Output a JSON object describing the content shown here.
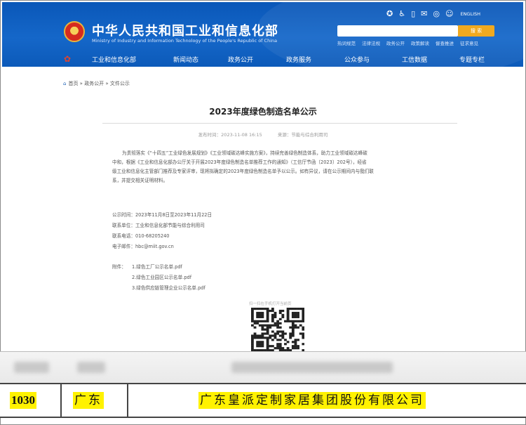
{
  "header": {
    "site_title": "中华人民共和国工业和信息化部",
    "site_subtitle": "Ministry of Industry and Information Technology of the People's Republic of China",
    "lang_link": "ENGLISH",
    "search_button": "搜 索",
    "hot_words": [
      "热词规范",
      "法律法规",
      "政务公开",
      "政策解读",
      "督查推进",
      "征求意见"
    ],
    "nav": [
      "工业和信息化部",
      "新闻动态",
      "政务公开",
      "政务服务",
      "公众参与",
      "工信数据",
      "专题专栏"
    ],
    "top_icons": [
      "weibo-icon",
      "accessibility-icon",
      "bookmark-icon",
      "mail-icon",
      "weibo-icon",
      "wechat-icon"
    ]
  },
  "breadcrumb": [
    "首页",
    "政务公开",
    "文件公示"
  ],
  "article": {
    "title": "2023年度绿色制造名单公示",
    "date": "发布时间：2023-11-08 16:15",
    "source": "来源：节能与综合利用司",
    "para1_lines": [
      "为贯彻落实《“十四五”工业绿色发展规划》《工业领域碳达峰实施方案》，持续完善绿色制造体系，助力工业领域碳达峰碳",
      "中和，根据《工业和信息化部办公厅关于开展2023年度绿色制造名单推荐工作的通知》（工信厅节函〔2023〕202号），经省",
      "级工业和信息化主管部门推荐及专家评审，现将拟确定的2023年度绿色制造名单予以公示。如有异议，请在公示期间内与我们联",
      "系，并提交相关证明材料。"
    ],
    "period": "公示时间：2023年11月8日至2023年11月22日",
    "unit": "联系单位：工业和信息化部节能与综合利用司",
    "phone": "联系电话：010-68205240",
    "email": "电子邮件：hbc@miit.gov.cn",
    "attachments_label": "附件：",
    "attachments": [
      "1.绿色工厂公示名单.pdf",
      "2.绿色工业园区公示名单.pdf",
      "3.绿色供应链管理企业公示名单.pdf"
    ],
    "qr_label": "扫一扫在手机打开当前页"
  },
  "table_row": {
    "number": "1030",
    "province": "广东",
    "company": "广东皇派定制家居集团股份有限公司"
  },
  "colors": {
    "header_blue": "#0a57b8",
    "search_orange": "#f0a91f",
    "highlight": "#fff200"
  }
}
